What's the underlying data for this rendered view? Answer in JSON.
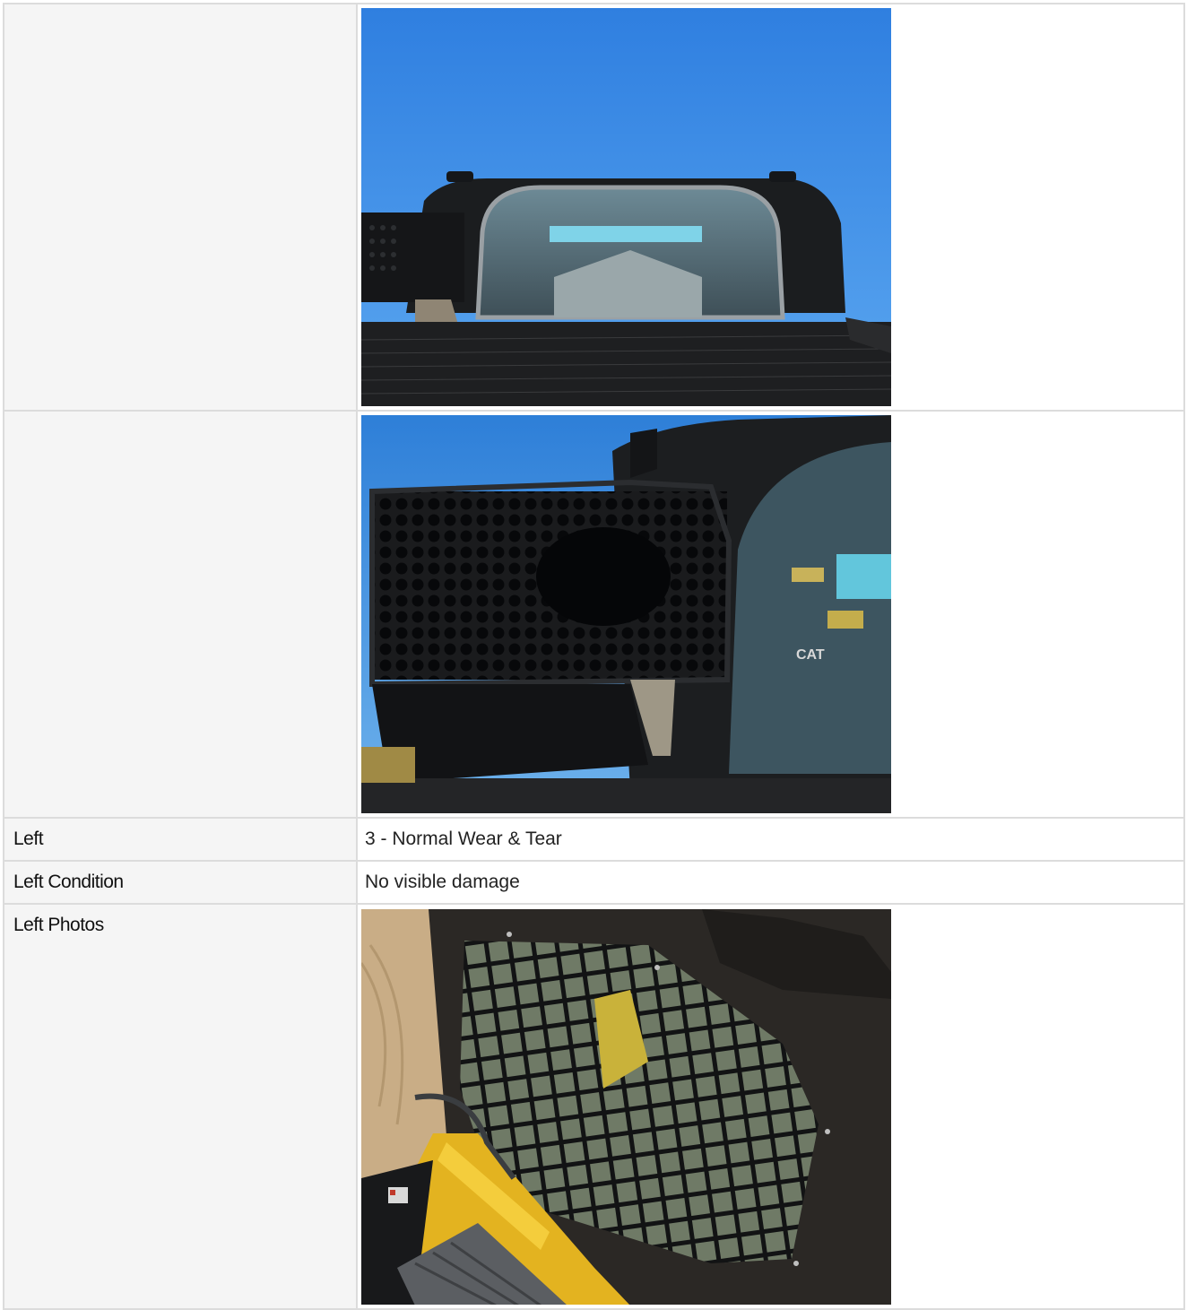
{
  "rows": [
    {
      "label": "",
      "type": "photo",
      "photo": "cab-rear-window-photo"
    },
    {
      "label": "",
      "type": "photo",
      "photo": "cab-side-vent-photo"
    },
    {
      "label": "Left",
      "type": "text",
      "value": "3 - Normal Wear & Tear"
    },
    {
      "label": "Left Condition",
      "type": "text",
      "value": "No visible damage"
    },
    {
      "label": "Left Photos",
      "type": "photo",
      "photo": "cab-left-door-screen-photo"
    }
  ]
}
